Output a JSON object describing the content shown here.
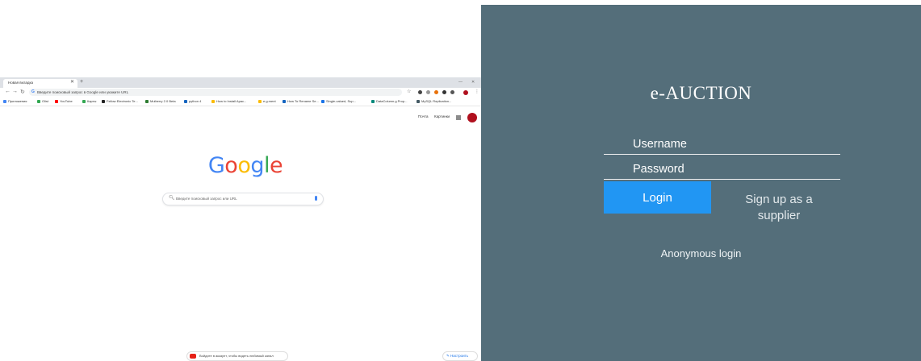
{
  "browser": {
    "tab_title": "Новая вкладка",
    "address_text": "Введите поисковый запрос в Google или укажите URL",
    "bookmarks": [
      {
        "label": "Приложения",
        "color": "#4285f4"
      },
      {
        "label": "Olist",
        "color": "#34a853"
      },
      {
        "label": "YouTube",
        "color": "#ff0000"
      },
      {
        "label": "Карты",
        "color": "#34a853"
      },
      {
        "label": "Fellow Electronic Te...",
        "color": "#222222"
      },
      {
        "label": "Mulberry 2.0 Beta",
        "color": "#2e7d32"
      },
      {
        "label": "python 4",
        "color": "#1565c0"
      },
      {
        "label": "How to Install Apac...",
        "color": "#fbbc05"
      },
      {
        "label": "e.g.ment",
        "color": "#fbbc05"
      },
      {
        "label": "How To Rename Se...",
        "color": "#1565c0"
      },
      {
        "label": "Single-valued, Sup...",
        "color": "#1a73e8"
      },
      {
        "label": "DataColumn.g Prop...",
        "color": "#00897b"
      },
      {
        "label": "MySQL Replication...",
        "color": "#455a64"
      }
    ],
    "top_links": [
      "Почта",
      "Картинки"
    ],
    "google_logo": [
      {
        "char": "G",
        "color": "#4285f4"
      },
      {
        "char": "o",
        "color": "#ea4335"
      },
      {
        "char": "o",
        "color": "#fbbc05"
      },
      {
        "char": "g",
        "color": "#4285f4"
      },
      {
        "char": "l",
        "color": "#34a853"
      },
      {
        "char": "e",
        "color": "#ea4335"
      }
    ],
    "search_placeholder": "Введите поисковый запрос или URL",
    "youtube_promo": "Войдите в аккаунт, чтобы видеть любимый канал",
    "customize_label": "Настроить"
  },
  "login": {
    "title": "e-AUCTION",
    "username_placeholder": "Username",
    "password_placeholder": "Password",
    "login_label": "Login",
    "signup_line1": "Sign up as a",
    "signup_line2": "supplier",
    "anonymous_label": "Anonymous login",
    "panel_color": "#546e7a",
    "button_color": "#2196f3"
  }
}
